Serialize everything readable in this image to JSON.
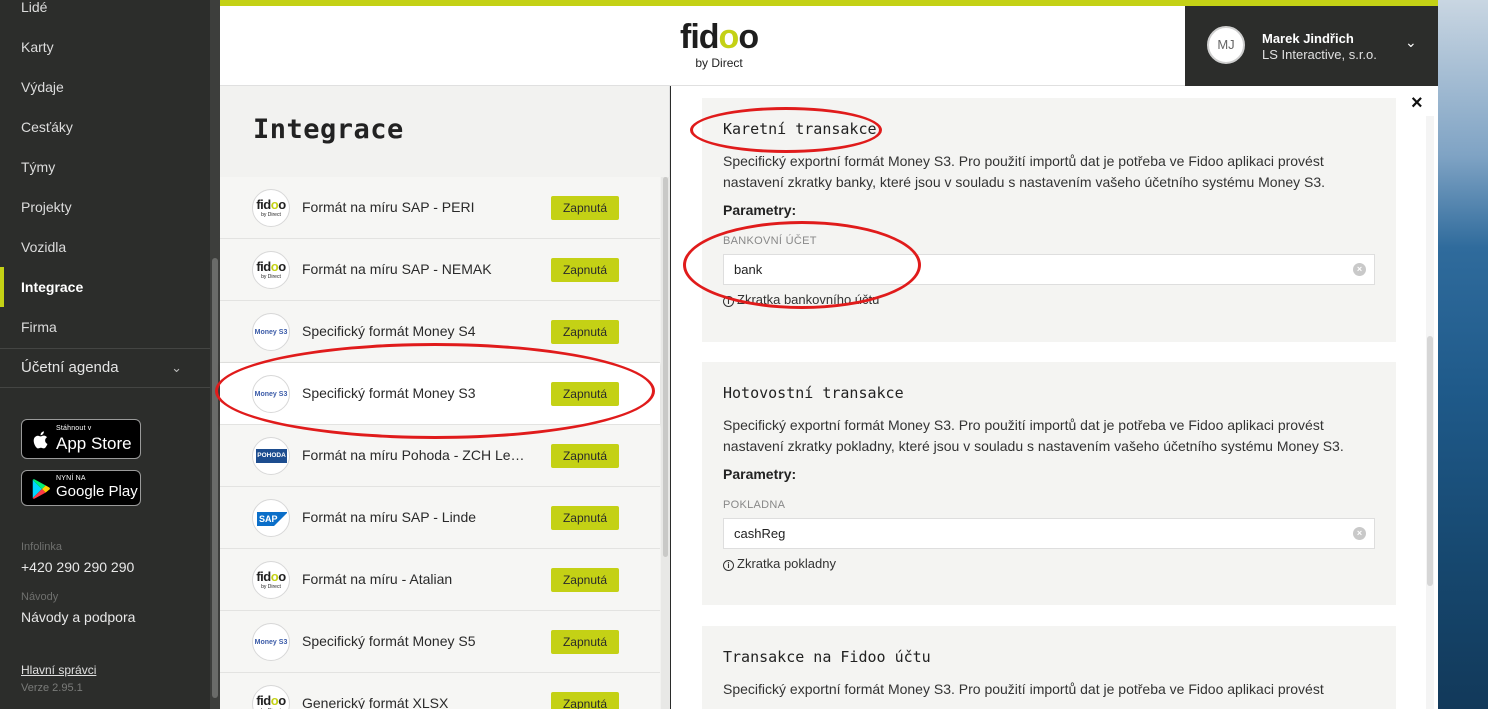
{
  "sidebar": {
    "items": [
      {
        "label": "Lidé"
      },
      {
        "label": "Karty"
      },
      {
        "label": "Výdaje"
      },
      {
        "label": "Cesťáky"
      },
      {
        "label": "Týmy"
      },
      {
        "label": "Projekty"
      },
      {
        "label": "Vozidla"
      },
      {
        "label": "Integrace",
        "active": true
      },
      {
        "label": "Firma"
      }
    ],
    "agenda_label": "Účetní agenda",
    "app_store": {
      "small": "Stáhnout v",
      "big": "App Store"
    },
    "google_play": {
      "small": "NYNÍ NA",
      "big": "Google Play"
    },
    "infoline_label": "Infolinka",
    "infoline_value": "+420 290 290 290",
    "guides_label": "Návody",
    "guides_value": "Návody a podpora",
    "admins_link": "Hlavní správci",
    "version": "Verze 2.95.1"
  },
  "header": {
    "brand_word": "fidoo",
    "brand_sub": "by Direct",
    "user_initials": "MJ",
    "user_name": "Marek Jindřich",
    "user_company": "LS Interactive, s.r.o."
  },
  "integrations": {
    "title": "Integrace",
    "status_label": "Zapnutá",
    "items": [
      {
        "name": "Formát na míru SAP - PERI",
        "logo": "fidoo"
      },
      {
        "name": "Formát na míru SAP - NEMAK",
        "logo": "fidoo"
      },
      {
        "name": "Specifický formát Money S4",
        "logo": "money"
      },
      {
        "name": "Specifický formát Money S3",
        "logo": "money",
        "selected": true
      },
      {
        "name": "Formát na míru Pohoda - ZCH Le…",
        "logo": "pohoda"
      },
      {
        "name": "Formát na míru SAP - Linde",
        "logo": "sap"
      },
      {
        "name": "Formát na míru - Atalian",
        "logo": "fidoo"
      },
      {
        "name": "Specifický formát Money S5",
        "logo": "money"
      },
      {
        "name": "Generický formát XLSX",
        "logo": "fidoo"
      }
    ],
    "logo_texts": {
      "fidoo_sub": "by Direct",
      "money": "Money S3",
      "pohoda": "POHODA",
      "sap": "SAP"
    }
  },
  "detail": {
    "close": "×",
    "params_label": "Parametry:",
    "cards": [
      {
        "title": "Karetní transakce",
        "desc": "Specifický exportní formát Money S3. Pro použití importů dat je potřeba ve Fidoo aplikaci provést nastavení zkratky banky, které jsou v souladu s nastavením vašeho účetního systému Money S3.",
        "field_label": "BANKOVNÍ ÚČET",
        "field_value": "bank",
        "hint": "Zkratka bankovního účtu"
      },
      {
        "title": "Hotovostní transakce",
        "desc": "Specifický exportní formát Money S3. Pro použití importů dat je potřeba ve Fidoo aplikaci provést nastavení zkratky pokladny, které jsou v souladu s nastavením vašeho účetního systému Money S3.",
        "field_label": "POKLADNA",
        "field_value": "cashReg",
        "hint": "Zkratka pokladny"
      },
      {
        "title": "Transakce na Fidoo účtu",
        "desc": "Specifický exportní formát Money S3. Pro použití importů dat je potřeba ve Fidoo aplikaci provést"
      }
    ]
  },
  "colors": {
    "accent": "#c4d115",
    "annotation": "#e01b1b",
    "sidebar_bg": "#2c2d2b"
  }
}
